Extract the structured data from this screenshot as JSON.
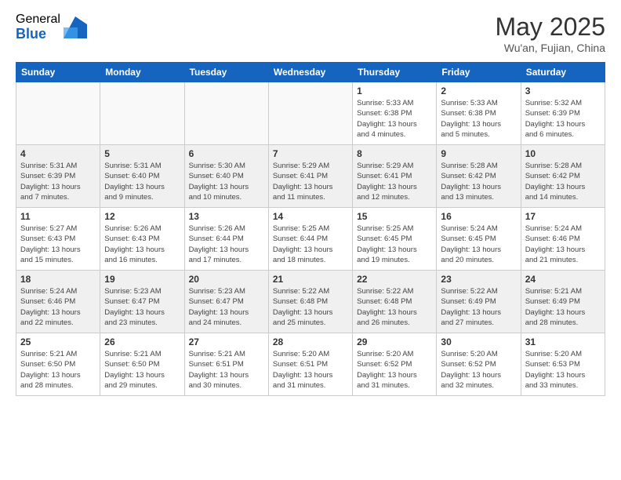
{
  "header": {
    "logo_general": "General",
    "logo_blue": "Blue",
    "month_title": "May 2025",
    "subtitle": "Wu'an, Fujian, China"
  },
  "weekdays": [
    "Sunday",
    "Monday",
    "Tuesday",
    "Wednesday",
    "Thursday",
    "Friday",
    "Saturday"
  ],
  "weeks": [
    [
      {
        "day": "",
        "info": ""
      },
      {
        "day": "",
        "info": ""
      },
      {
        "day": "",
        "info": ""
      },
      {
        "day": "",
        "info": ""
      },
      {
        "day": "1",
        "info": "Sunrise: 5:33 AM\nSunset: 6:38 PM\nDaylight: 13 hours\nand 4 minutes."
      },
      {
        "day": "2",
        "info": "Sunrise: 5:33 AM\nSunset: 6:38 PM\nDaylight: 13 hours\nand 5 minutes."
      },
      {
        "day": "3",
        "info": "Sunrise: 5:32 AM\nSunset: 6:39 PM\nDaylight: 13 hours\nand 6 minutes."
      }
    ],
    [
      {
        "day": "4",
        "info": "Sunrise: 5:31 AM\nSunset: 6:39 PM\nDaylight: 13 hours\nand 7 minutes."
      },
      {
        "day": "5",
        "info": "Sunrise: 5:31 AM\nSunset: 6:40 PM\nDaylight: 13 hours\nand 9 minutes."
      },
      {
        "day": "6",
        "info": "Sunrise: 5:30 AM\nSunset: 6:40 PM\nDaylight: 13 hours\nand 10 minutes."
      },
      {
        "day": "7",
        "info": "Sunrise: 5:29 AM\nSunset: 6:41 PM\nDaylight: 13 hours\nand 11 minutes."
      },
      {
        "day": "8",
        "info": "Sunrise: 5:29 AM\nSunset: 6:41 PM\nDaylight: 13 hours\nand 12 minutes."
      },
      {
        "day": "9",
        "info": "Sunrise: 5:28 AM\nSunset: 6:42 PM\nDaylight: 13 hours\nand 13 minutes."
      },
      {
        "day": "10",
        "info": "Sunrise: 5:28 AM\nSunset: 6:42 PM\nDaylight: 13 hours\nand 14 minutes."
      }
    ],
    [
      {
        "day": "11",
        "info": "Sunrise: 5:27 AM\nSunset: 6:43 PM\nDaylight: 13 hours\nand 15 minutes."
      },
      {
        "day": "12",
        "info": "Sunrise: 5:26 AM\nSunset: 6:43 PM\nDaylight: 13 hours\nand 16 minutes."
      },
      {
        "day": "13",
        "info": "Sunrise: 5:26 AM\nSunset: 6:44 PM\nDaylight: 13 hours\nand 17 minutes."
      },
      {
        "day": "14",
        "info": "Sunrise: 5:25 AM\nSunset: 6:44 PM\nDaylight: 13 hours\nand 18 minutes."
      },
      {
        "day": "15",
        "info": "Sunrise: 5:25 AM\nSunset: 6:45 PM\nDaylight: 13 hours\nand 19 minutes."
      },
      {
        "day": "16",
        "info": "Sunrise: 5:24 AM\nSunset: 6:45 PM\nDaylight: 13 hours\nand 20 minutes."
      },
      {
        "day": "17",
        "info": "Sunrise: 5:24 AM\nSunset: 6:46 PM\nDaylight: 13 hours\nand 21 minutes."
      }
    ],
    [
      {
        "day": "18",
        "info": "Sunrise: 5:24 AM\nSunset: 6:46 PM\nDaylight: 13 hours\nand 22 minutes."
      },
      {
        "day": "19",
        "info": "Sunrise: 5:23 AM\nSunset: 6:47 PM\nDaylight: 13 hours\nand 23 minutes."
      },
      {
        "day": "20",
        "info": "Sunrise: 5:23 AM\nSunset: 6:47 PM\nDaylight: 13 hours\nand 24 minutes."
      },
      {
        "day": "21",
        "info": "Sunrise: 5:22 AM\nSunset: 6:48 PM\nDaylight: 13 hours\nand 25 minutes."
      },
      {
        "day": "22",
        "info": "Sunrise: 5:22 AM\nSunset: 6:48 PM\nDaylight: 13 hours\nand 26 minutes."
      },
      {
        "day": "23",
        "info": "Sunrise: 5:22 AM\nSunset: 6:49 PM\nDaylight: 13 hours\nand 27 minutes."
      },
      {
        "day": "24",
        "info": "Sunrise: 5:21 AM\nSunset: 6:49 PM\nDaylight: 13 hours\nand 28 minutes."
      }
    ],
    [
      {
        "day": "25",
        "info": "Sunrise: 5:21 AM\nSunset: 6:50 PM\nDaylight: 13 hours\nand 28 minutes."
      },
      {
        "day": "26",
        "info": "Sunrise: 5:21 AM\nSunset: 6:50 PM\nDaylight: 13 hours\nand 29 minutes."
      },
      {
        "day": "27",
        "info": "Sunrise: 5:21 AM\nSunset: 6:51 PM\nDaylight: 13 hours\nand 30 minutes."
      },
      {
        "day": "28",
        "info": "Sunrise: 5:20 AM\nSunset: 6:51 PM\nDaylight: 13 hours\nand 31 minutes."
      },
      {
        "day": "29",
        "info": "Sunrise: 5:20 AM\nSunset: 6:52 PM\nDaylight: 13 hours\nand 31 minutes."
      },
      {
        "day": "30",
        "info": "Sunrise: 5:20 AM\nSunset: 6:52 PM\nDaylight: 13 hours\nand 32 minutes."
      },
      {
        "day": "31",
        "info": "Sunrise: 5:20 AM\nSunset: 6:53 PM\nDaylight: 13 hours\nand 33 minutes."
      }
    ]
  ]
}
